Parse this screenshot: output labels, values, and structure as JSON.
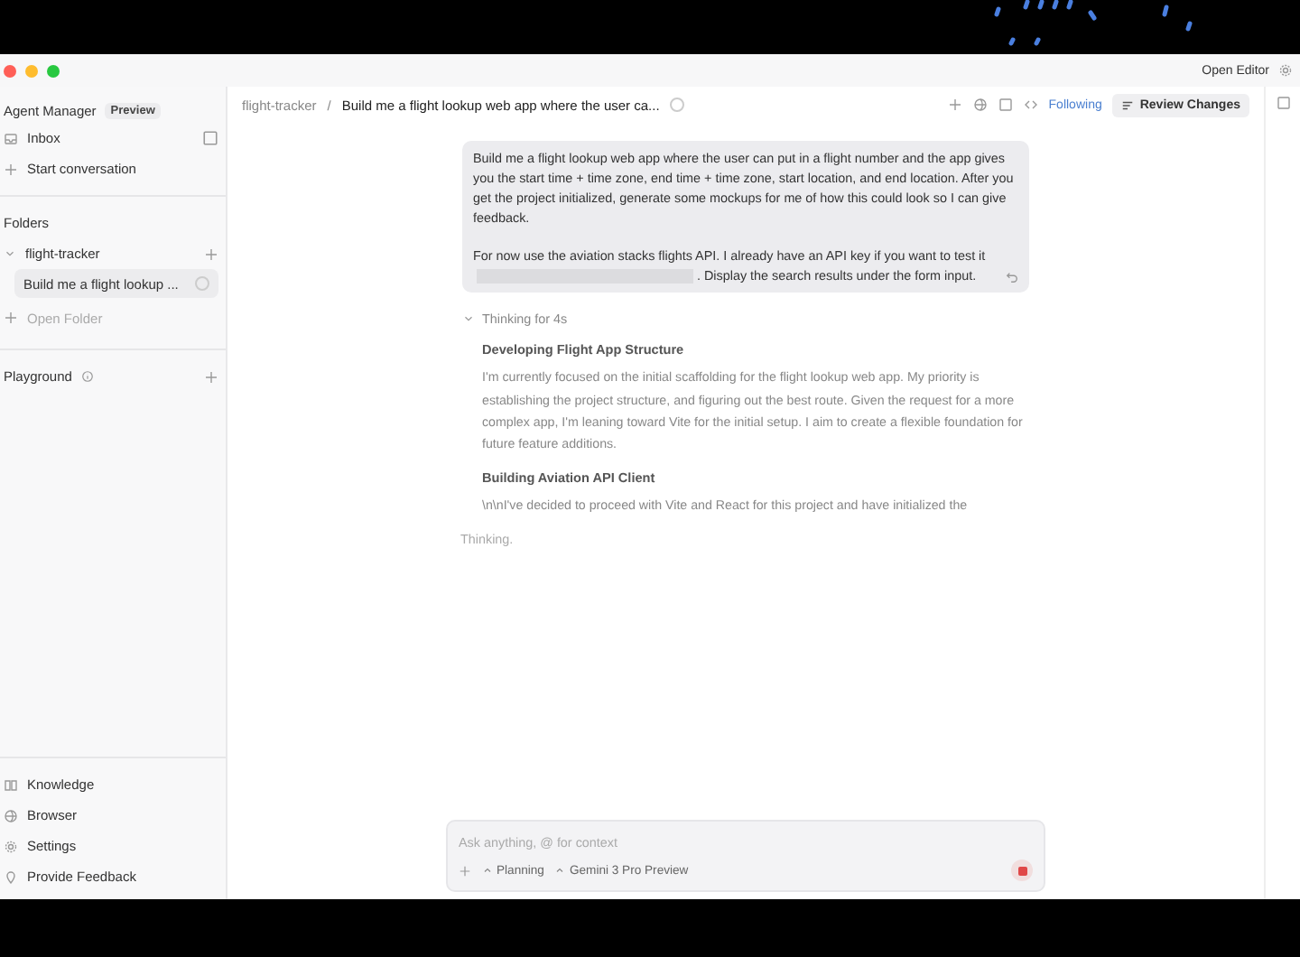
{
  "titlebar": {
    "open_editor": "Open Editor"
  },
  "sidebar": {
    "title": "Agent Manager",
    "badge": "Preview",
    "top_items": [
      {
        "kind": "inbox",
        "label": "Inbox"
      },
      {
        "kind": "add",
        "label": "Start conversation"
      }
    ],
    "folders_heading": "Folders",
    "folders": [
      {
        "label": "flight-tracker",
        "expanded": true,
        "children": [
          {
            "label": "Build me a flight lookup ...",
            "selected": true,
            "running": true
          }
        ]
      }
    ],
    "open_folder": "Open Folder",
    "playground": "Playground",
    "bottom_items": [
      {
        "kind": "book",
        "label": "Knowledge"
      },
      {
        "kind": "globe",
        "label": "Browser"
      },
      {
        "kind": "gear",
        "label": "Settings"
      },
      {
        "kind": "pin",
        "label": "Provide Feedback"
      }
    ]
  },
  "header": {
    "separator": "/",
    "breadcrumb": [
      "flight-tracker",
      "Build me a flight lookup web app where the user ca..."
    ],
    "running": true,
    "following": "Following",
    "review": "Review Changes"
  },
  "message": {
    "paragraphs": [
      "Build me a flight lookup web app where the user can put in a flight number and the app gives you the start time + time zone, end time + time zone, start location, and end location. After you get the project initialized, generate some mockups for me of how this could look so I can give feedback."
    ],
    "before_redacted": "For now use the aviation stacks flights API. I already have an API key if you want to test it",
    "after_redacted": ". Display the search results under the form input."
  },
  "thinking": {
    "label": "Thinking for 4s",
    "expanded": true,
    "sections": [
      {
        "heading": "Developing Flight App Structure",
        "text": "I'm currently focused on the initial scaffolding for the flight lookup web app. My priority is establishing the project structure, and figuring out the best route. Given the request for a more complex app, I'm leaning toward Vite for the initial setup. I aim to create a flexible foundation for future feature additions."
      },
      {
        "heading": "Building Aviation API Client",
        "text": "\\n\\nI've decided to proceed with Vite and React for this project and have initialized the"
      }
    ]
  },
  "status": "Thinking.",
  "composer": {
    "placeholder": "Ask anything, @ for context",
    "mode": "Planning",
    "model": "Gemini 3 Pro Preview",
    "running": true
  }
}
